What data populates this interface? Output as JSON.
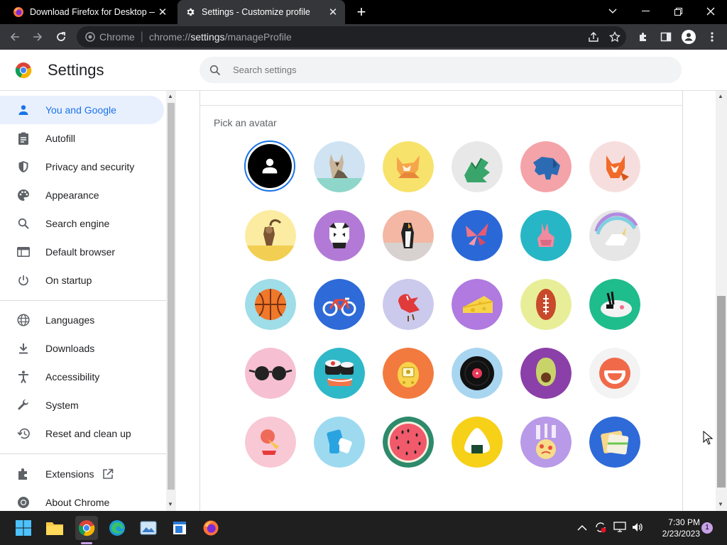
{
  "tabs": [
    {
      "title": "Download Firefox for Desktop —",
      "icon": "firefox-icon",
      "active": false
    },
    {
      "title": "Settings - Customize profile",
      "icon": "gear-icon",
      "active": true
    }
  ],
  "toolbar": {
    "site_label": "Chrome",
    "url_prefix": "chrome://",
    "url_host": "settings",
    "url_path": "/manageProfile"
  },
  "header": {
    "title": "Settings",
    "search_placeholder": "Search settings"
  },
  "sidebar": {
    "items": [
      {
        "label": "You and Google",
        "icon": "person-icon",
        "active": true
      },
      {
        "label": "Autofill",
        "icon": "clipboard-icon"
      },
      {
        "label": "Privacy and security",
        "icon": "shield-icon"
      },
      {
        "label": "Appearance",
        "icon": "palette-icon"
      },
      {
        "label": "Search engine",
        "icon": "search-icon"
      },
      {
        "label": "Default browser",
        "icon": "browser-window-icon"
      },
      {
        "label": "On startup",
        "icon": "power-icon"
      },
      {
        "label": "Languages",
        "icon": "globe-icon"
      },
      {
        "label": "Downloads",
        "icon": "download-icon"
      },
      {
        "label": "Accessibility",
        "icon": "accessibility-icon"
      },
      {
        "label": "System",
        "icon": "wrench-icon"
      },
      {
        "label": "Reset and clean up",
        "icon": "restore-icon"
      },
      {
        "label": "Extensions",
        "icon": "puzzle-icon"
      },
      {
        "label": "About Chrome",
        "icon": "chrome-icon"
      }
    ]
  },
  "main": {
    "section_title": "Pick an avatar",
    "selected_avatar": "generic-person",
    "avatars": [
      "generic-person",
      "origami-cat",
      "origami-fox",
      "origami-dragon",
      "origami-elephant",
      "origami-red-fox",
      "origami-monkey",
      "origami-panda",
      "origami-penguin",
      "origami-butterfly",
      "origami-rabbit",
      "origami-unicorn",
      "basketball",
      "bicycle",
      "red-bird",
      "cheese",
      "football",
      "rice-bowl",
      "sunglasses",
      "sushi",
      "tamagotchi",
      "vinyl-record",
      "avocado",
      "smiley",
      "ice-cream",
      "ice-cubes",
      "watermelon",
      "onigiri",
      "pizza",
      "sandwich"
    ]
  },
  "taskbar": {
    "time": "7:30 PM",
    "date": "2/23/2023",
    "notification_count": "1"
  },
  "colors": {
    "accent": "#1a73e8",
    "active_bg": "#e8f0fe",
    "tabstrip": "#000000",
    "toolbar": "#35363a"
  }
}
